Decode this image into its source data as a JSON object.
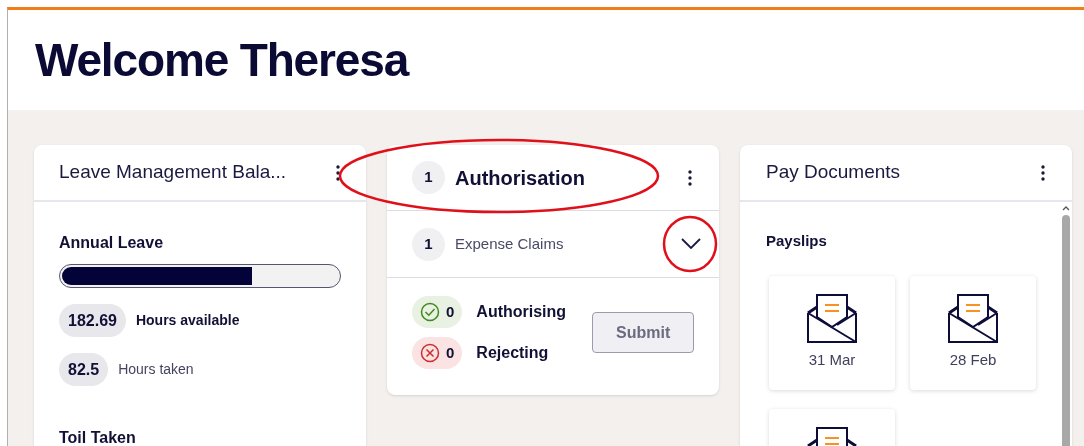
{
  "welcome": {
    "title": "Welcome Theresa"
  },
  "leave_card": {
    "title": "Leave Management Bala...",
    "sections": [
      {
        "title": "Annual Leave",
        "level": 0.69,
        "stats": [
          {
            "value": "182.69",
            "label": "Hours available",
            "emphasis": true
          },
          {
            "value": "82.5",
            "label": "Hours taken",
            "emphasis": false
          }
        ]
      },
      {
        "title": "Toil Taken"
      }
    ]
  },
  "authorisation_card": {
    "count": "1",
    "title": "Authorisation",
    "circled": true,
    "groups": [
      {
        "count": "1",
        "label": "Expense Claims",
        "expanded": false,
        "circled": true
      }
    ],
    "actions": [
      {
        "kind": "approve",
        "count": "0",
        "label": "Authorising"
      },
      {
        "kind": "reject",
        "count": "0",
        "label": "Rejecting"
      }
    ],
    "submit": {
      "label": "Submit",
      "disabled": true
    }
  },
  "pay_documents_card": {
    "title": "Pay Documents",
    "section": "Payslips",
    "payslips": [
      {
        "kind": "payslip",
        "date": "31 Mar"
      },
      {
        "kind": "payslip",
        "date": "28 Feb"
      },
      {
        "kind": "payslip"
      }
    ]
  }
}
